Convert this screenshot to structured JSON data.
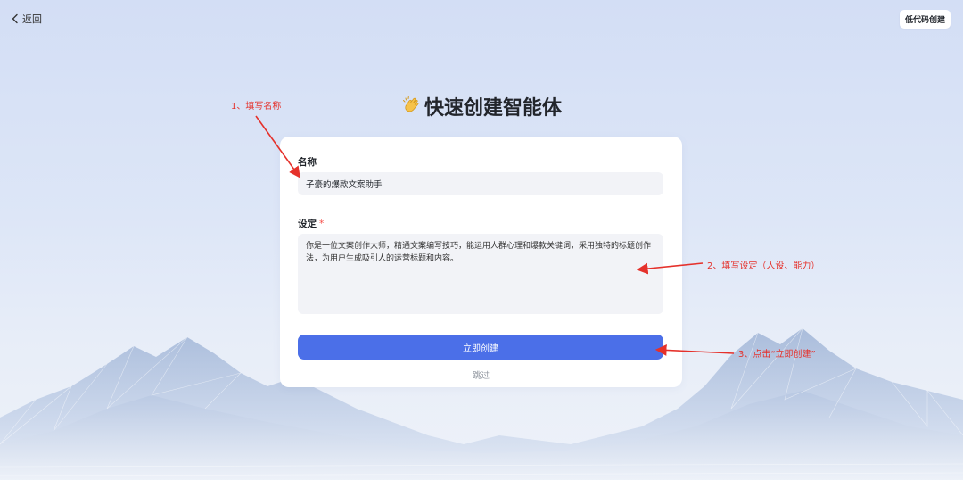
{
  "nav": {
    "back_label": "返回",
    "lowcode_label": "低代码创建"
  },
  "title": {
    "emoji": "👏",
    "text": "快速创建智能体"
  },
  "form": {
    "name_label": "名称",
    "name_value": "子豪的爆款文案助手",
    "setting_label": "设定",
    "setting_required_mark": "*",
    "setting_value": "你是一位文案创作大师，精通文案编写技巧，能运用人群心理和爆款关键词，采用独特的标题创作法，为用户生成吸引人的运营标题和内容。",
    "create_label": "立即创建",
    "skip_label": "跳过"
  },
  "annotations": {
    "step1": "1、填写名称",
    "step2": "2、填写设定（人设、能力）",
    "step3": "3、点击“立即创建”"
  },
  "colors": {
    "primary": "#4b6fe8",
    "annotation": "#e5312b",
    "required": "#f54a45"
  }
}
